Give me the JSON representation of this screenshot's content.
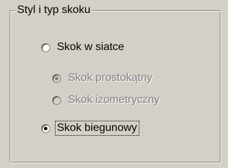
{
  "group": {
    "title": "Styl i typ skoku"
  },
  "options": {
    "grid": {
      "label": "Skok w siatce",
      "selected": false,
      "enabled": true
    },
    "rect": {
      "label": "Skok prostokątny",
      "selected": true,
      "enabled": false
    },
    "iso": {
      "label": "Skok izometryczny",
      "selected": false,
      "enabled": false
    },
    "polar": {
      "label": "Skok biegunowy",
      "selected": true,
      "enabled": true,
      "focused": true
    }
  }
}
